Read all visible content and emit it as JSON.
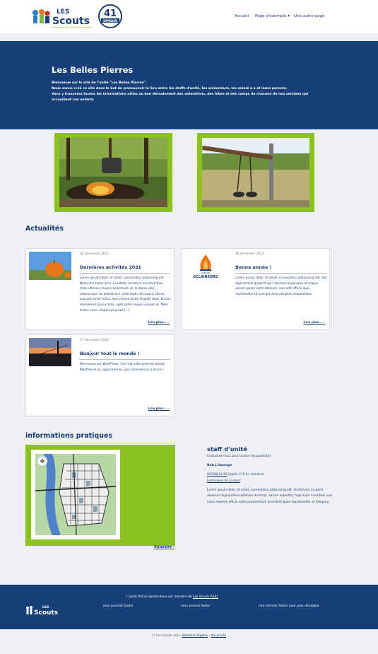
{
  "header": {
    "logo_text": "LES SCOUTS",
    "logo_tagline": "Fédération des Scouts de Belgique",
    "badge_number": "41",
    "badge_text": "DPNAIN",
    "nav": [
      {
        "label": "Accueil"
      },
      {
        "label": "Page d'exemple ▾"
      },
      {
        "label": "Une autre page"
      }
    ]
  },
  "hero": {
    "title": "Les Belles Pierres",
    "intro_lines": [
      "Bienvenue sur le site de l'unité \"Les Belles Pierres\".",
      "Nous avons créé ce site dans le but de promouvoir le lien entre les staffs d'unité, les animateurs, les animé·e·s et leurs parents.",
      "Vous y trouverez toutes les informations utiles au bon déroulement des animations, des hikes et des camps de chacune de nos sections qui accueillent vos enfants"
    ]
  },
  "news": {
    "title": "Actualités",
    "cards": [
      {
        "date": "28 décembre 2022",
        "title": "Dernières activités 2021",
        "excerpt": "Lorem ipsum dolor sit amet, consectetur adipiscing elit. Nulla non tellus arcu. Curabitur tincidunt euismod felis, vitae ultricies mauris sollicitudin id. In libero odio, ullamcorper ac pharetra in, sollicitudin et massa. Donec suscipit tortor tellus, non viverra tortor feugiat vitae. Donec elementum purus felis, eget porta neque suscipit ut. Nam lectus nunc, aliquet ut purus [...]",
        "more": "Lire plus...",
        "image": "pumpkin-photo"
      },
      {
        "date": "28 décembre 2022",
        "title": "Bonne année !",
        "excerpt": "Lorem ipsum dolor sit amet, consectetur adipisicing elit. Aut dignissimos quaerat qui! Aperiam asperiores et eaque earum ipsam iusto laborum, non odit officia quas repellendus sit suscipit vero voluptas voluptatibus.",
        "more": "Lire plus...",
        "image": "eclaireurs-logo",
        "logo_text_top": "Scouts",
        "logo_text_bottom": "ECLAIREURS"
      },
      {
        "date": "27 décembre 2022",
        "title": "Bonjour tout le monde !",
        "excerpt": "Bienvenue sur WordPress. Ceci est votre premier article. Modifiez-le ou supprimez-le, puis commencez à écrire !",
        "more": "Lire plus...",
        "image": "sunset-photo"
      }
    ]
  },
  "info": {
    "title": "informations pratiques",
    "itinerary": "Itinéraire",
    "staff_title": "staff d'unité",
    "staff_sub": "Contactez-nous pour toutes vos questions",
    "staff_name": "Bob L'éponge",
    "staff_phone": "02/508.12.00",
    "staff_hours": "(après 17h en semaine)",
    "staff_form": "Formulaire de contact",
    "staff_text": "Lorem ipsum dolor sit amet, consectetur adipisicing elit. Architecto, corporis deserunt dignissimos dolorum ducimus, earum expedita, fuga illum inventore iure iusto maxime officia optio praesentium provident quas repudiandae sit tempore."
  },
  "footer": {
    "member_prefix": "L'unité fictive Sainte-Anne est membre de",
    "member_link": "Les Scouts ASBL",
    "logo_text": "LES SCOUTS",
    "columns": [
      "mon premier footer",
      "mon second footer",
      "mon dernier footer avec plus de blabla"
    ],
    "copyright": "© Les Scouts asbl -",
    "legal": "Mentions légales",
    "privacy": "Vie privée"
  },
  "colors": {
    "navy": "#173f78",
    "green": "#8cc220",
    "page_bg": "#eef0f5"
  }
}
